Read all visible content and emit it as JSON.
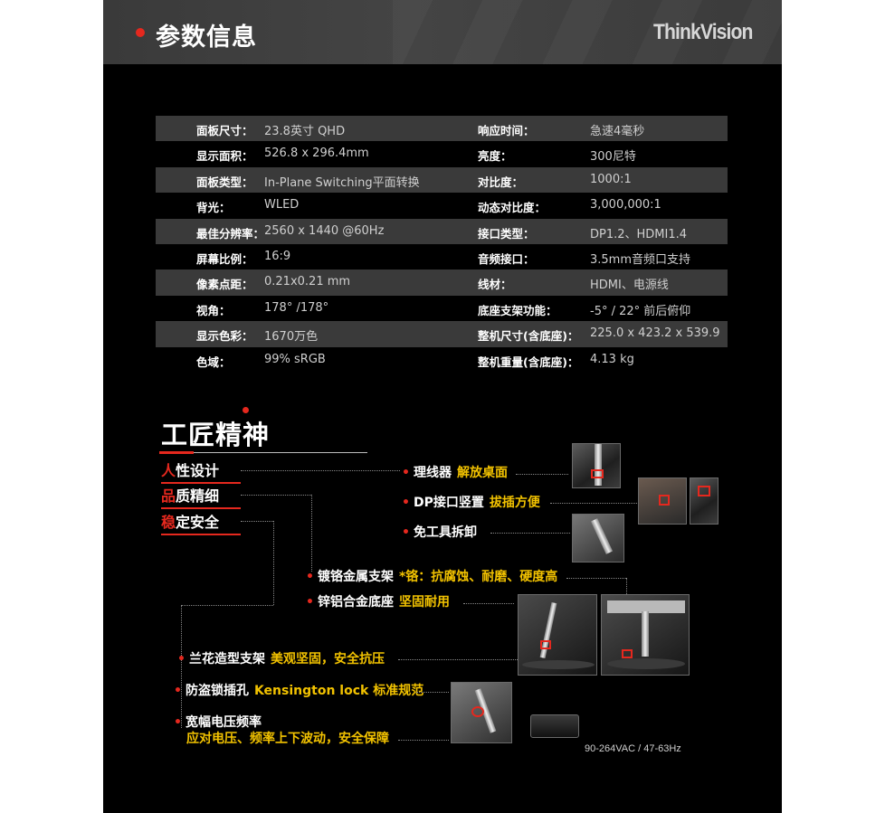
{
  "header": {
    "title": "参数信息",
    "brand": "ThinkVision"
  },
  "specs": [
    {
      "k1": "面板尺寸：",
      "v1": "23.8英寸 QHD",
      "k2": "响应时间：",
      "v2": "急速4毫秒"
    },
    {
      "k1": "显示面积：",
      "v1": "526.8 x 296.4mm",
      "k2": "亮度：",
      "v2": "300尼特"
    },
    {
      "k1": "面板类型：",
      "v1": "In-Plane Switching平面转换",
      "k2": "对比度：",
      "v2": "1000:1"
    },
    {
      "k1": "背光：",
      "v1": "WLED",
      "k2": "动态对比度：",
      "v2": "3,000,000:1"
    },
    {
      "k1": "最佳分辨率：",
      "v1": "2560 x 1440 @60Hz",
      "k2": "接口类型：",
      "v2": "DP1.2、HDMI1.4"
    },
    {
      "k1": "屏幕比例：",
      "v1": "16:9",
      "k2": "音频接口：",
      "v2": "3.5mm音频口支持"
    },
    {
      "k1": "像素点距：",
      "v1": "0.21x0.21 mm",
      "k2": "线材：",
      "v2": "HDMI、电源线"
    },
    {
      "k1": "视角：",
      "v1": "178° /178°",
      "k2": "底座支架功能：",
      "v2": "-5° / 22° 前后俯仰"
    },
    {
      "k1": "显示色彩：",
      "v1": "1670万色",
      "k2": "整机尺寸(含底座)：",
      "v2": " 225.0 x 423.2 x 539.9"
    },
    {
      "k1": "色域：",
      "v1": "99% sRGB",
      "k2": "整机重量(含底座)：",
      "v2": "4.13 kg"
    }
  ],
  "craft": {
    "title": "工匠精神",
    "pillars": [
      {
        "hl": "人",
        "rest": "性设计"
      },
      {
        "hl": "品",
        "rest": "质精细"
      },
      {
        "hl": "稳",
        "rest": "定安全"
      }
    ],
    "features": {
      "cable": {
        "label": "理线器",
        "note": "解放桌面"
      },
      "dp": {
        "label": "DP接口竖置",
        "note": "拔插方便"
      },
      "toolfree": {
        "label": "免工具拆卸"
      },
      "chrome": {
        "label": "镀铬金属支架",
        "note": "*铬：抗腐蚀、耐磨、硬度高"
      },
      "alloy": {
        "label": "锌铝合金底座",
        "note": "坚固耐用"
      },
      "orchid": {
        "label": "兰花造型支架",
        "note": "美观坚固，安全抗压"
      },
      "lock": {
        "label": "防盗锁插孔",
        "note": "Kensington lock 标准规范"
      },
      "voltage": {
        "label": "宽幅电压频率",
        "note": "应对电压、频率上下波动，安全保障"
      }
    },
    "power_spec": "90-264VAC / 47-63Hz"
  },
  "colors": {
    "accent_red": "#e5281e",
    "accent_yellow": "#f2c200",
    "row_shade": "#3a3a3a",
    "background": "#000000"
  }
}
